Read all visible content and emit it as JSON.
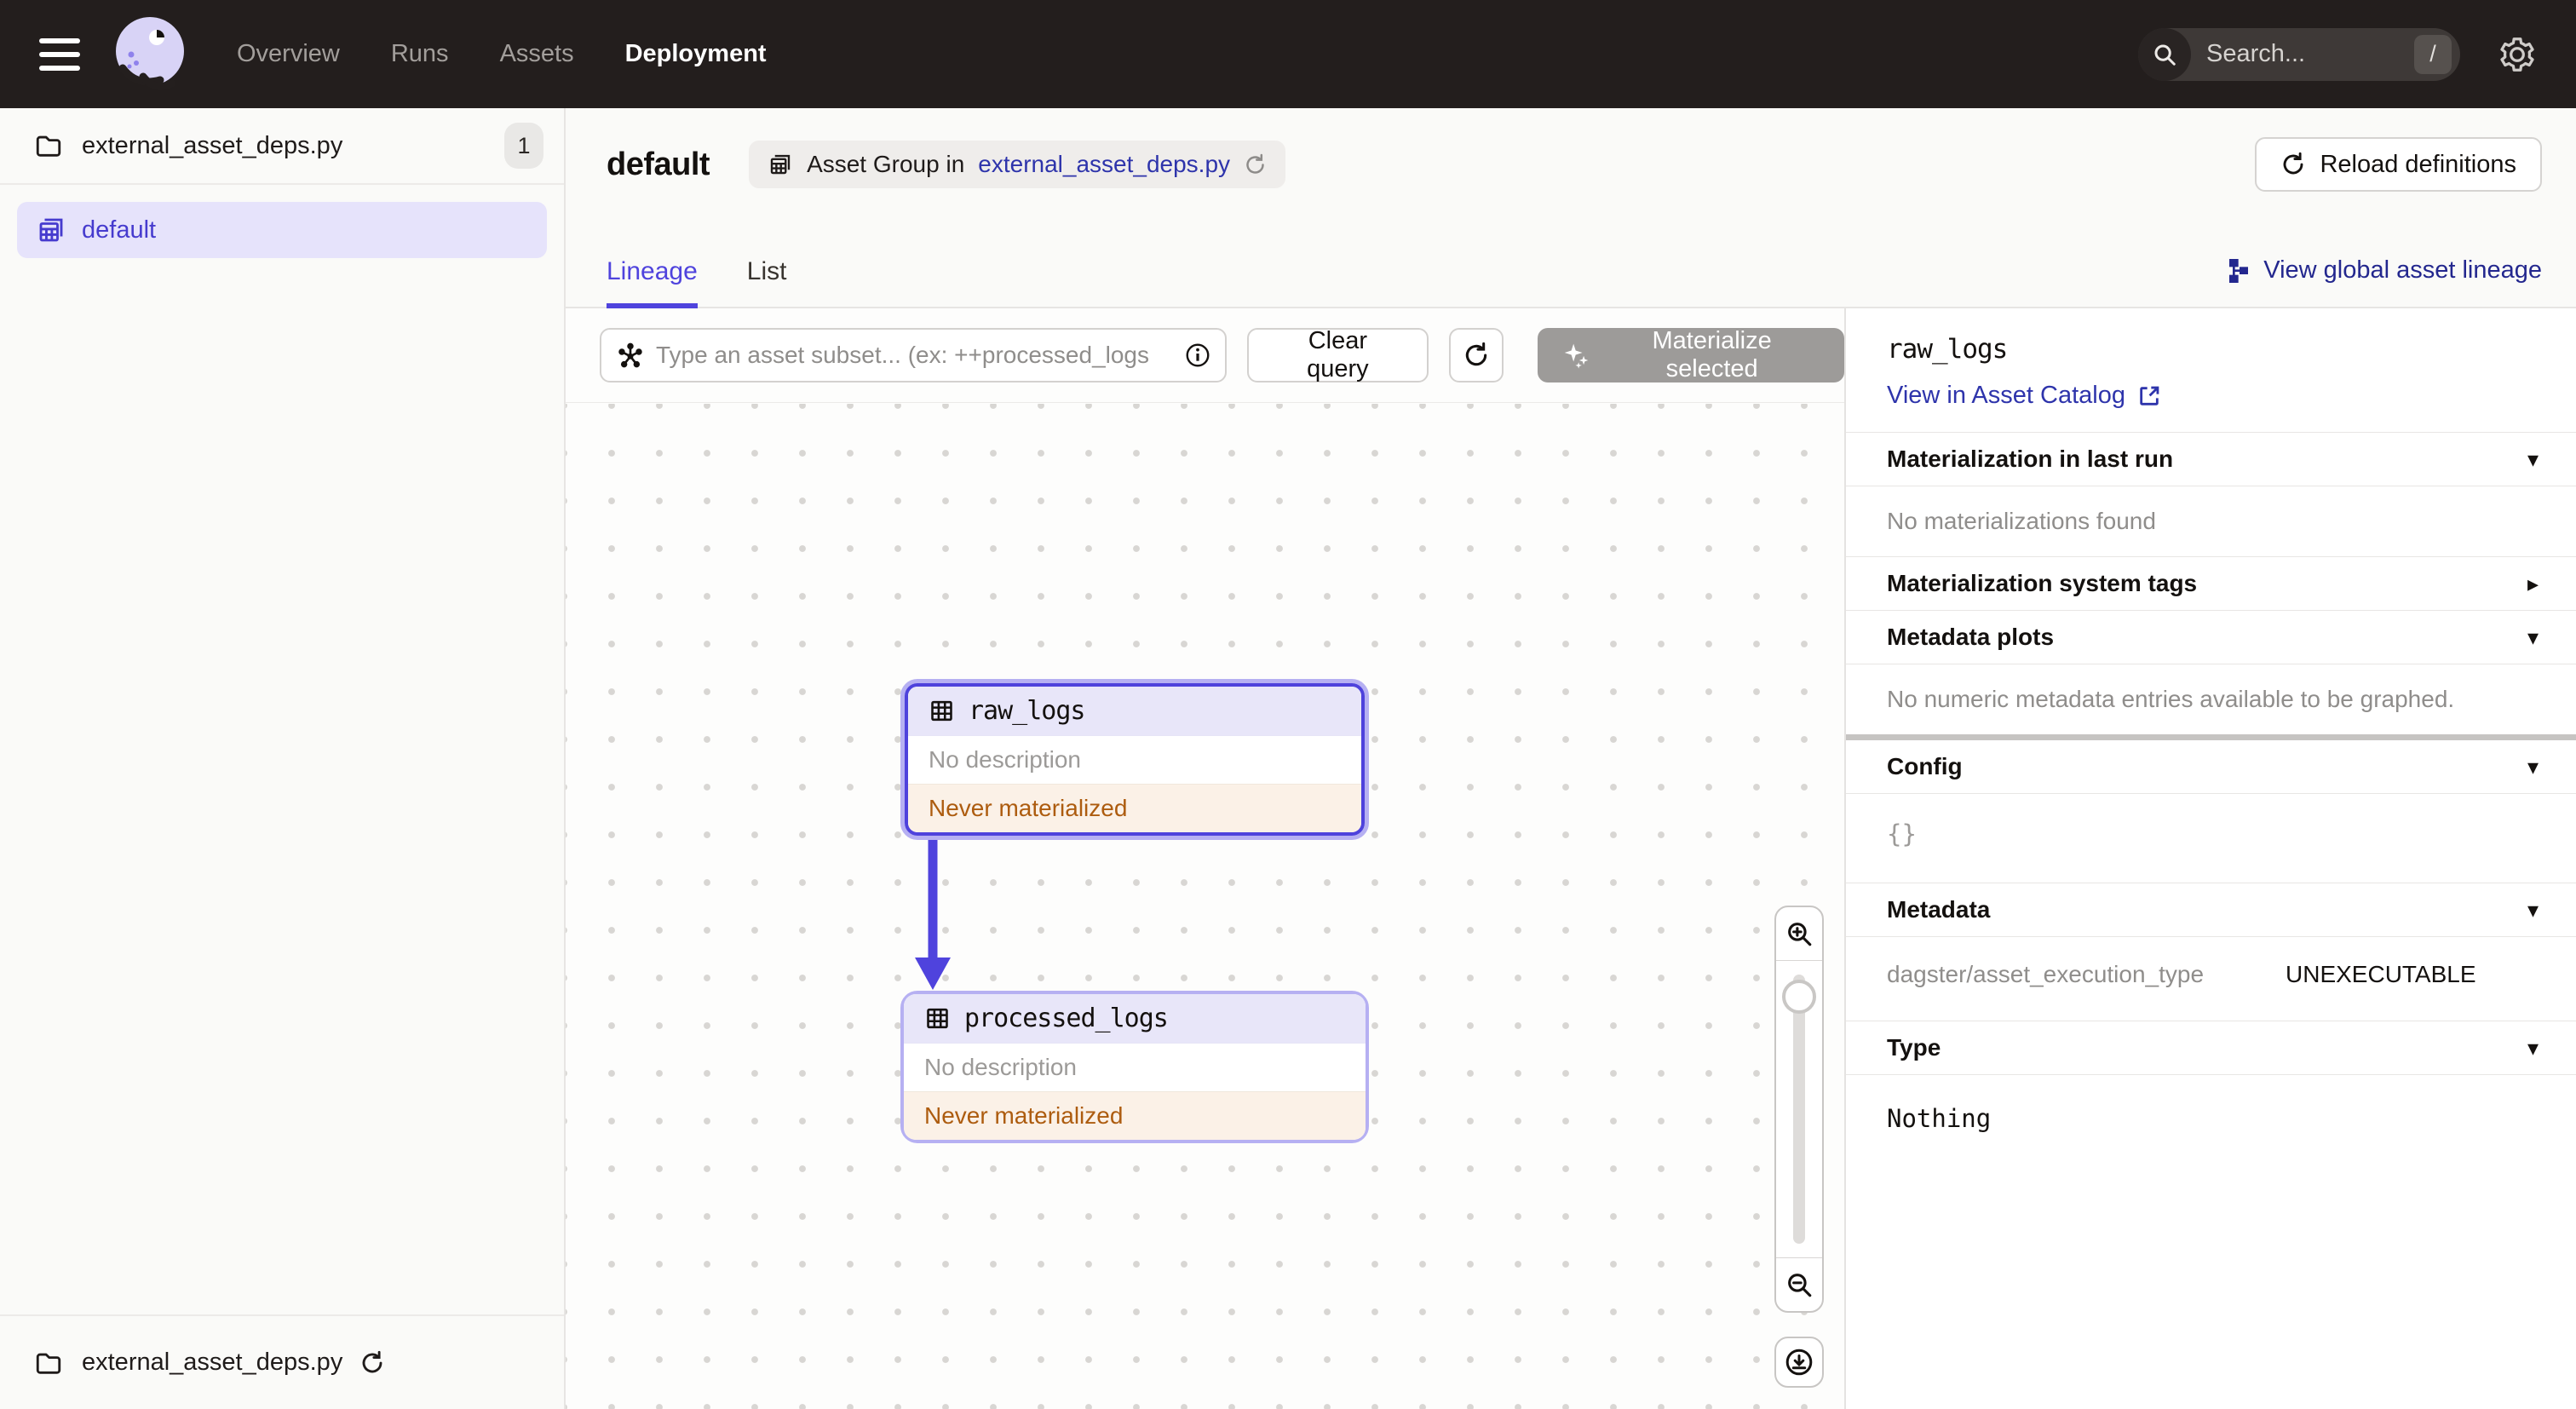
{
  "topnav": {
    "nav_items": [
      {
        "label": "Overview",
        "active": false
      },
      {
        "label": "Runs",
        "active": false
      },
      {
        "label": "Assets",
        "active": false
      },
      {
        "label": "Deployment",
        "active": true
      }
    ],
    "search": {
      "placeholder": "Search...",
      "shortcut": "/"
    }
  },
  "sidebar": {
    "repo": {
      "name": "external_asset_deps.py",
      "count": "1"
    },
    "groups": [
      {
        "label": "default",
        "selected": true
      }
    ],
    "footer": {
      "name": "external_asset_deps.py"
    }
  },
  "header": {
    "title": "default",
    "breadcrumb_prefix": "Asset Group in",
    "breadcrumb_link": "external_asset_deps.py",
    "reload_button": "Reload definitions"
  },
  "tabs": {
    "items": [
      {
        "label": "Lineage",
        "active": true
      },
      {
        "label": "List",
        "active": false
      }
    ],
    "global_lineage_link": "View global asset lineage"
  },
  "toolbar": {
    "query_placeholder": "Type an asset subset... (ex: ++processed_logs",
    "clear_button": "Clear query",
    "materialize_button": "Materialize selected"
  },
  "graph": {
    "nodes": [
      {
        "name": "raw_logs",
        "description": "No description",
        "status": "Never materialized",
        "selected": true
      },
      {
        "name": "processed_logs",
        "description": "No description",
        "status": "Never materialized",
        "selected": false
      }
    ]
  },
  "panel": {
    "title": "raw_logs",
    "catalog_link": "View in Asset Catalog",
    "sections": {
      "last_run": {
        "title": "Materialization in last run",
        "empty": "No materializations found"
      },
      "system_tags": {
        "title": "Materialization system tags"
      },
      "metadata_plots": {
        "title": "Metadata plots",
        "empty": "No numeric metadata entries available to be graphed."
      },
      "config": {
        "title": "Config",
        "value": "{}"
      },
      "metadata": {
        "title": "Metadata",
        "rows": [
          {
            "key": "dagster/asset_execution_type",
            "value": "UNEXECUTABLE"
          }
        ]
      },
      "type": {
        "title": "Type",
        "value": "Nothing"
      }
    }
  },
  "icons": {
    "caret_down": "▾",
    "caret_right": "▸"
  },
  "colors": {
    "accent": "#4F43DD",
    "nav_bg": "#231E1D",
    "link": "#2E34AB",
    "warning_text": "#AD5C0F",
    "warning_bg": "#FBF1E7",
    "selected_bg": "#E6E3FB"
  }
}
